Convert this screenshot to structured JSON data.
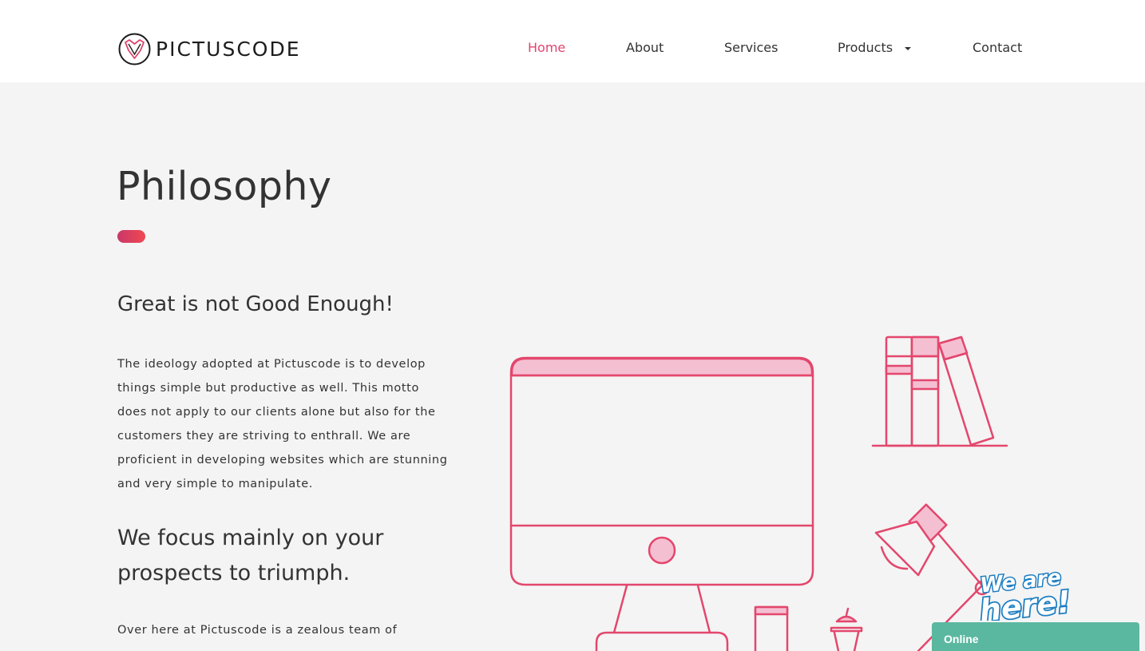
{
  "brand": {
    "name": "PICTUSCODE",
    "accent_color": "#e0456e",
    "logo_icon": "fox-head-icon"
  },
  "nav": {
    "home": "Home",
    "about": "About",
    "services": "Services",
    "products": "Products",
    "contact": "Contact",
    "active": "Home"
  },
  "section": {
    "title": "Philosophy",
    "heading_1": "Great is not Good Enough!",
    "paragraph_1": "The ideology adopted at Pictuscode is to develop things simple but productive as well. This motto does not apply to our clients alone but also for the customers they are striving to enthrall. We are proficient in developing websites which are stunning and very simple to manipulate.",
    "heading_2": "We focus mainly on your prospects to triumph.",
    "paragraph_2": "Over here at Pictuscode is a zealous team of"
  },
  "chat": {
    "badge": "We are here!",
    "status": "Online",
    "bar_color": "#5bb8a0"
  }
}
